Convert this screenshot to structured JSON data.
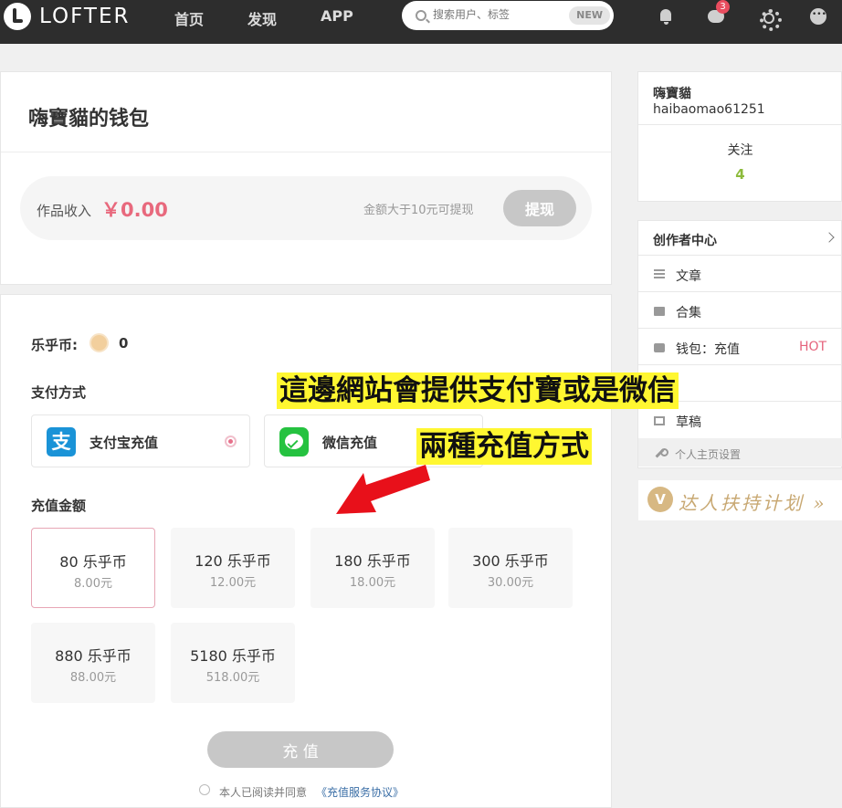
{
  "header": {
    "logo": "LOFTER",
    "nav": [
      "首页",
      "发现",
      "APP"
    ],
    "search_placeholder": "搜索用户、标签",
    "search_badge": "NEW",
    "message_count": "3"
  },
  "wallet": {
    "title": "嗨寶貓的钱包",
    "income_label": "作品收入",
    "income_value": "￥0.00",
    "withdraw_hint": "金额大于10元可提现",
    "withdraw_label": "提现"
  },
  "recharge": {
    "coins_label": "乐乎币:",
    "coins_value": "0",
    "pay_methods_label": "支付方式",
    "pay_methods": [
      {
        "label": "支付宝充值",
        "selected": true
      },
      {
        "label": "微信充值",
        "selected": false
      }
    ],
    "amount_label": "充值金额",
    "amounts": [
      {
        "coins": "80 乐乎币",
        "price": "8.00元",
        "selected": true
      },
      {
        "coins": "120 乐乎币",
        "price": "12.00元",
        "selected": false
      },
      {
        "coins": "180 乐乎币",
        "price": "18.00元",
        "selected": false
      },
      {
        "coins": "300 乐乎币",
        "price": "30.00元",
        "selected": false
      },
      {
        "coins": "880 乐乎币",
        "price": "88.00元",
        "selected": false
      },
      {
        "coins": "5180 乐乎币",
        "price": "518.00元",
        "selected": false
      }
    ],
    "submit_label": "充 值",
    "agree_text": "本人已阅读并同意",
    "agree_link": "《充值服务协议》"
  },
  "sidebar": {
    "name": "嗨寶貓",
    "user_id": "haibaomao61251",
    "follow_label": "关注",
    "follow_count": "4",
    "creator_title": "创作者中心",
    "menu": [
      {
        "label": "文章",
        "icon": "document-icon"
      },
      {
        "label": "合集",
        "icon": "folder-icon"
      },
      {
        "label": "钱包：充值",
        "icon": "wallet-icon",
        "badge": "HOT"
      },
      {
        "label": "草稿",
        "icon": "draft-icon"
      }
    ],
    "settings_label": "个人主页设置",
    "promo_icon_text": "V",
    "promo_text": "达人扶持计划 »"
  },
  "annotation": {
    "line1": "這邊網站會提供支付寶或是微信",
    "line2": "兩種充值方式"
  },
  "colors": {
    "topbar": "#2d2d2d",
    "accent_pink": "#e8697d",
    "follow_green": "#8dbb3c",
    "caption_yellow": "#fff731",
    "arrow_red": "#e8101a"
  }
}
